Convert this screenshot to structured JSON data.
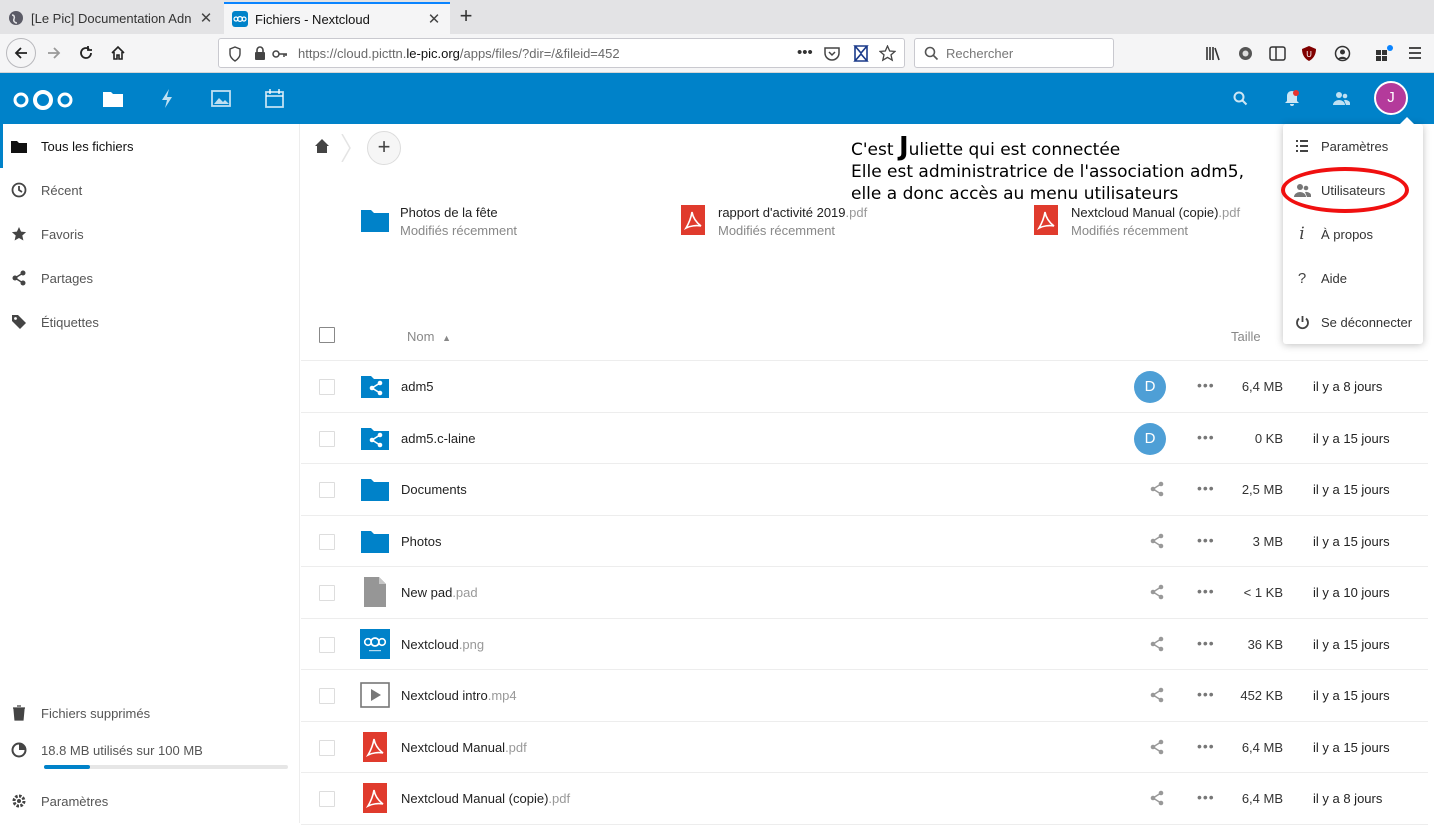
{
  "browser": {
    "tabs": [
      {
        "title": "[Le Pic] Documentation Adn",
        "active": false
      },
      {
        "title": "Fichiers - Nextcloud",
        "active": true
      }
    ],
    "url_prefix": "https://cloud.picttn.",
    "url_domain": "le-pic.org",
    "url_suffix": "/apps/files/?dir=/&fileid=452",
    "search_placeholder": "Rechercher"
  },
  "header": {
    "apps": [
      "files-icon",
      "activity-icon",
      "photos-icon",
      "calendar-icon"
    ],
    "avatar_initial": "J",
    "avatar_color": "#b43a9b",
    "brand_color": "#0082c9"
  },
  "sidebar": {
    "items": [
      {
        "label": "Tous les fichiers",
        "icon": "folder-icon"
      },
      {
        "label": "Récent",
        "icon": "clock-icon"
      },
      {
        "label": "Favoris",
        "icon": "star-icon"
      },
      {
        "label": "Partages",
        "icon": "share-icon"
      },
      {
        "label": "Étiquettes",
        "icon": "tag-icon"
      }
    ],
    "deleted": "Fichiers supprimés",
    "quota": "18.8 MB utilisés sur 100 MB",
    "quota_fraction": 0.188,
    "settings": "Paramètres"
  },
  "annotation": {
    "line1_pre": "C'est ",
    "line1_big": "J",
    "line1_post": "uliette qui est connectée",
    "line2": "Elle est administratrice de l'association adm5,",
    "line3": "elle a donc accès au menu utilisateurs"
  },
  "recent": [
    {
      "name": "Photos de la fête",
      "ext": "",
      "sub": "Modifiés récemment",
      "type": "folder"
    },
    {
      "name": "rapport d'activité 2019",
      "ext": ".pdf",
      "sub": "Modifiés récemment",
      "type": "pdf"
    },
    {
      "name": "Nextcloud Manual (copie)",
      "ext": ".pdf",
      "sub": "Modifiés récemment",
      "type": "pdf"
    }
  ],
  "table": {
    "col_name": "Nom",
    "col_size": "Taille",
    "rows": [
      {
        "name": "adm5",
        "ext": "",
        "type": "shared-folder",
        "share": "D",
        "size": "6,4 MB",
        "date": "il y a 8 jours"
      },
      {
        "name": "adm5.c-laine",
        "ext": "",
        "type": "shared-folder",
        "share": "D",
        "size": "0 KB",
        "date": "il y a 15 jours"
      },
      {
        "name": "Documents",
        "ext": "",
        "type": "folder",
        "share": "",
        "size": "2,5 MB",
        "date": "il y a 15 jours"
      },
      {
        "name": "Photos",
        "ext": "",
        "type": "folder",
        "share": "",
        "size": "3 MB",
        "date": "il y a 15 jours"
      },
      {
        "name": "New pad",
        "ext": ".pad",
        "type": "pad",
        "share": "",
        "size": "< 1 KB",
        "date": "il y a 10 jours"
      },
      {
        "name": "Nextcloud",
        "ext": ".png",
        "type": "image",
        "share": "",
        "size": "36 KB",
        "date": "il y a 15 jours"
      },
      {
        "name": "Nextcloud intro",
        "ext": ".mp4",
        "type": "video",
        "share": "",
        "size": "452 KB",
        "date": "il y a 15 jours"
      },
      {
        "name": "Nextcloud Manual",
        "ext": ".pdf",
        "type": "pdf",
        "share": "",
        "size": "6,4 MB",
        "date": "il y a 15 jours"
      },
      {
        "name": "Nextcloud Manual (copie)",
        "ext": ".pdf",
        "type": "pdf",
        "share": "",
        "size": "6,4 MB",
        "date": "il y a 8 jours"
      }
    ]
  },
  "menu": {
    "items": [
      {
        "label": "Paramètres",
        "icon": "settings-list-icon"
      },
      {
        "label": "Utilisateurs",
        "icon": "users-icon"
      },
      {
        "label": "À propos",
        "icon": "info-icon"
      },
      {
        "label": "Aide",
        "icon": "help-icon"
      },
      {
        "label": "Se déconnecter",
        "icon": "power-icon"
      }
    ],
    "highlight_color": "#f01010"
  }
}
